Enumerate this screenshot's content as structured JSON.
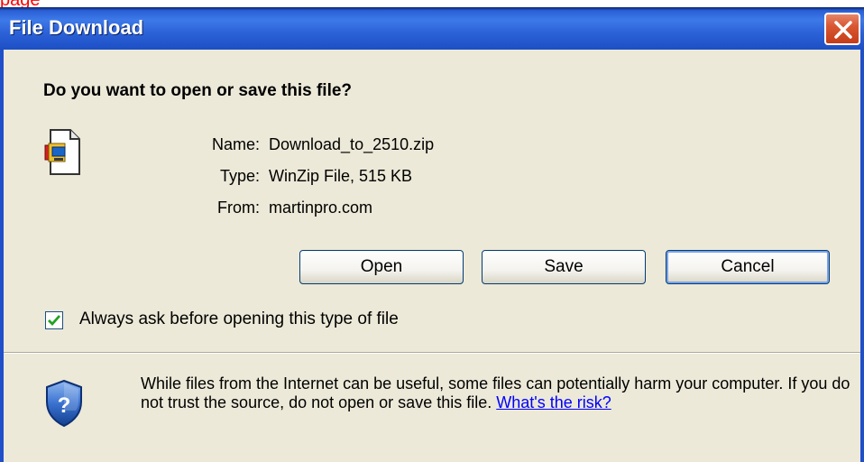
{
  "window": {
    "stray_text": "page",
    "title": "File Download",
    "close_label": "Close"
  },
  "prompt": {
    "question": "Do you want to open or save this file?"
  },
  "file": {
    "name_label": "Name:",
    "name_value": "Download_to_2510.zip",
    "type_label": "Type:",
    "type_value": "WinZip File, 515 KB",
    "from_label": "From:",
    "from_value": "martinpro.com",
    "icon": "winzip-file-icon"
  },
  "buttons": {
    "open": "Open",
    "save": "Save",
    "cancel": "Cancel"
  },
  "checkbox": {
    "label": "Always ask before opening this type of file",
    "checked": true
  },
  "warning": {
    "text": "While files from the Internet can be useful, some files can potentially harm your computer. If you do not trust the source, do not open or save this file.",
    "link": "What's the risk?",
    "icon": "security-shield-icon"
  },
  "colors": {
    "titlebar": "#2c62d8",
    "dialog_bg": "#ece9d8",
    "close_button": "#d95732",
    "link": "#0000ff"
  }
}
